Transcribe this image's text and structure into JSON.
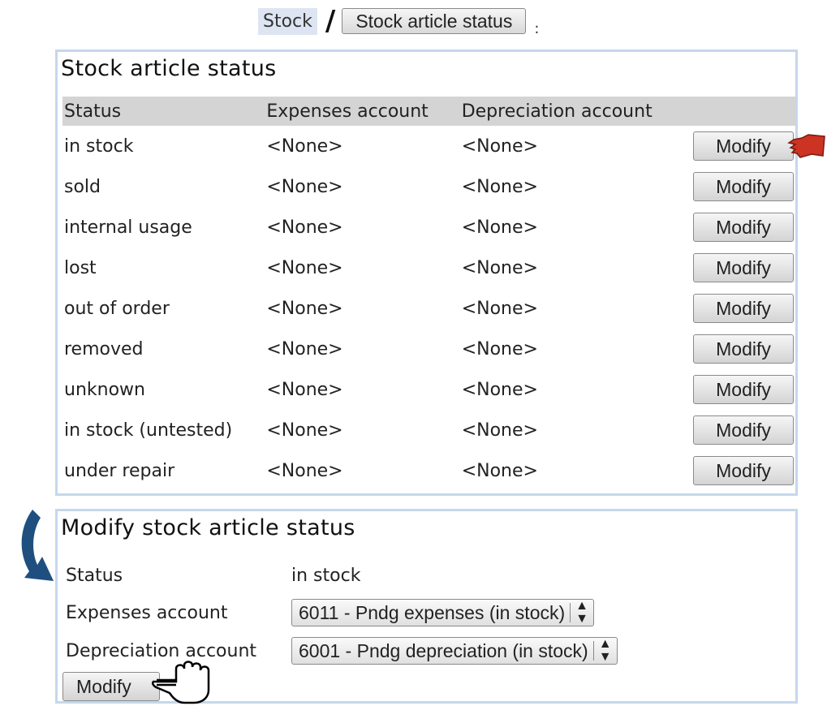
{
  "breadcrumb": {
    "stock_label": "Stock",
    "separator": "/",
    "current_button": "Stock article status",
    "tail": ":"
  },
  "status_panel": {
    "title": "Stock article status",
    "columns": [
      "Status",
      "Expenses account",
      "Depreciation account",
      ""
    ],
    "rows": [
      {
        "status": "in stock",
        "expenses": "<None>",
        "depreciation": "<None>",
        "action": "Modify"
      },
      {
        "status": "sold",
        "expenses": "<None>",
        "depreciation": "<None>",
        "action": "Modify"
      },
      {
        "status": "internal usage",
        "expenses": "<None>",
        "depreciation": "<None>",
        "action": "Modify"
      },
      {
        "status": "lost",
        "expenses": "<None>",
        "depreciation": "<None>",
        "action": "Modify"
      },
      {
        "status": "out of order",
        "expenses": "<None>",
        "depreciation": "<None>",
        "action": "Modify"
      },
      {
        "status": "removed",
        "expenses": "<None>",
        "depreciation": "<None>",
        "action": "Modify"
      },
      {
        "status": "unknown",
        "expenses": "<None>",
        "depreciation": "<None>",
        "action": "Modify"
      },
      {
        "status": "in stock (untested)",
        "expenses": "<None>",
        "depreciation": "<None>",
        "action": "Modify"
      },
      {
        "status": "under repair",
        "expenses": "<None>",
        "depreciation": "<None>",
        "action": "Modify"
      }
    ]
  },
  "modify_panel": {
    "title": "Modify stock article status",
    "status_label": "Status",
    "status_value": "in stock",
    "expenses_label": "Expenses account",
    "expenses_selected": "6011 - Pndg expenses (in stock)",
    "depreciation_label": "Depreciation account",
    "depreciation_selected": "6001 - Pndg depreciation (in stock)",
    "submit_label": "Modify"
  },
  "colors": {
    "panel_border": "#c6d7ec",
    "header_bg": "#d4d4d4",
    "crumb_bg": "#dde4f2",
    "arrow_blue": "#1f4f7f",
    "pointer_red": "#cc3322"
  },
  "icons": {
    "pointer_red": "pointing-hand-icon",
    "curved_arrow": "curved-arrow-icon",
    "pointer_outline": "hand-cursor-icon"
  }
}
